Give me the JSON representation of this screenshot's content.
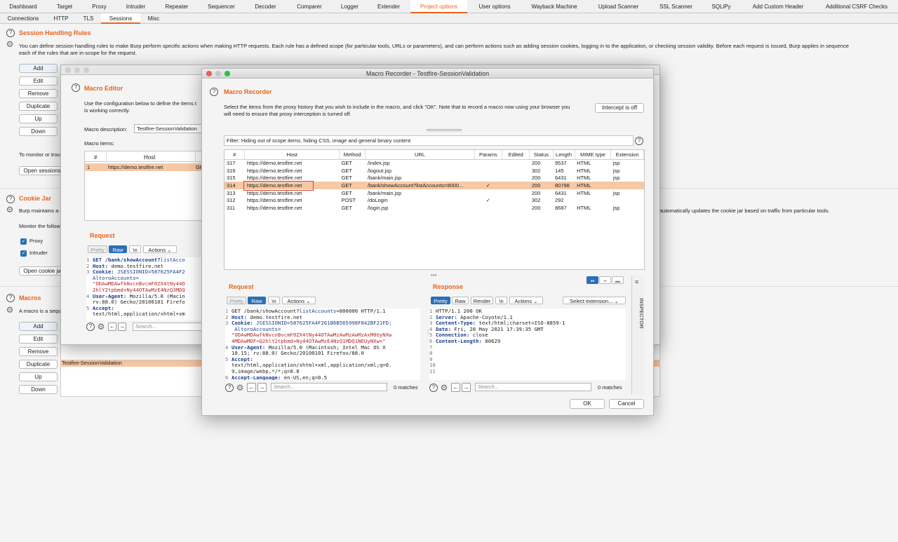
{
  "top_tabs": [
    {
      "label": "Dashboard",
      "active": false
    },
    {
      "label": "Target",
      "active": false
    },
    {
      "label": "Proxy",
      "active": false
    },
    {
      "label": "Intruder",
      "active": false
    },
    {
      "label": "Repeater",
      "active": false
    },
    {
      "label": "Sequencer",
      "active": false
    },
    {
      "label": "Decoder",
      "active": false
    },
    {
      "label": "Comparer",
      "active": false
    },
    {
      "label": "Logger",
      "active": false
    },
    {
      "label": "Extender",
      "active": false
    },
    {
      "label": "Project options",
      "active": true
    },
    {
      "label": "User options",
      "active": false
    },
    {
      "label": "Wayback Machine",
      "active": false
    },
    {
      "label": "Upload Scanner",
      "active": false
    },
    {
      "label": "SSL Scanner",
      "active": false
    },
    {
      "label": "SQLiPy",
      "active": false
    },
    {
      "label": "Add Custom Header",
      "active": false
    },
    {
      "label": "Additional CSRF Checks",
      "active": false
    }
  ],
  "sub_tabs": [
    {
      "label": "Connections",
      "active": false
    },
    {
      "label": "HTTP",
      "active": false
    },
    {
      "label": "TLS",
      "active": false
    },
    {
      "label": "Sessions",
      "active": true
    },
    {
      "label": "Misc",
      "active": false
    }
  ],
  "session_rules": {
    "title": "Session Handling Rules",
    "desc1": "You can define session handling rules to make Burp perform specific actions when making HTTP requests. Each rule has a defined scope (for particular tools, URLs or parameters), and can perform actions such as adding session cookies, logging in to the application, or checking session validity. Before each request is issued, Burp applies in sequence",
    "desc2": "each of the rules that are in-scope for the request.",
    "buttons": [
      "Add",
      "Edit",
      "Remove",
      "Duplicate",
      "Up",
      "Down"
    ],
    "monitor_text": "To monitor or trou",
    "open_sessions_btn": "Open sessions"
  },
  "cookie_jar": {
    "title": "Cookie Jar",
    "desc": "Burp maintains a c",
    "desc_right": "automatically updates the cookie jar based on traffic from particular tools.",
    "monitor": "Monitor the followi",
    "proxy": "Proxy",
    "intruder": "Intruder",
    "open_btn": "Open cookie ja"
  },
  "macros": {
    "title": "Macros",
    "desc": "A macro is a sequ",
    "buttons": [
      "Add",
      "Edit",
      "Remove",
      "Duplicate",
      "Up",
      "Down"
    ],
    "selected_macro": "Testfire-SessionValidation"
  },
  "macro_editor": {
    "title": "Macro Editor",
    "desc1": "Use the configuration below to define the items t",
    "desc2": "is working correctly.",
    "desc_label": "Macro description:",
    "desc_value": "Testfire-SessionValidation",
    "items_label": "Macro items:",
    "col_num": "#",
    "col_host": "Host",
    "row_num": "1",
    "row_host": "https://demo.testfire.net",
    "row_extra": "GE",
    "request_title": "Request",
    "pretty": "Pretty",
    "raw": "Raw",
    "newline": "\\n",
    "actions": "Actions",
    "search_placeholder": "Search...",
    "code": [
      {
        "n": "1",
        "k": "GET /bank/showAccount?",
        "v": "listAcco",
        "cls": "hval-blue"
      },
      {
        "n": "2",
        "k": "Host:",
        "v": " demo.testfire.net",
        "cls": ""
      },
      {
        "n": "3",
        "k": "Cookie:",
        "v": " JSESSIONID=587625FA4F2",
        "cls": "hval-blue"
      },
      {
        "n": "",
        "k": "",
        "v": "AltoroAccounts=",
        "cls": "hval-blue"
      },
      {
        "n": "",
        "k": "",
        "v": "\"ODAwMDAwfkNvcnBvcmF0ZX4tNy44O",
        "cls": "hval-red"
      },
      {
        "n": "",
        "k": "",
        "v": "2hlY2tpbmd+Ny44OTAwMzE4NzQ3MDQ",
        "cls": "hval-red"
      },
      {
        "n": "4",
        "k": "User-Agent:",
        "v": " Mozilla/5.0 (Macin",
        "cls": ""
      },
      {
        "n": "",
        "k": "",
        "v": "rv:88.0) Gecko/20100101 Firefo",
        "cls": ""
      },
      {
        "n": "5",
        "k": "Accept:",
        "v": "",
        "cls": ""
      },
      {
        "n": "",
        "k": "",
        "v": "text/html,application/xhtml+xm",
        "cls": ""
      }
    ]
  },
  "macro_recorder": {
    "window_title": "Macro Recorder - Testfire-SessionValidation",
    "title": "Macro Recorder",
    "desc1": "Select the items from the proxy history that you wish to include in the macro, and click \"OK\". Note that to record a macro now using your browser you",
    "desc2": "will need to ensure that proxy interception is turned off.",
    "intercept_btn": "Intercept is off",
    "filter": "Filter: Hiding out of scope items;  hiding CSS, image and general binary content",
    "columns": [
      "#",
      "Host",
      "Method",
      "URL",
      "Params",
      "Edited",
      "Status",
      "Length",
      "MIME type",
      "Extension"
    ],
    "rows": [
      {
        "num": "317",
        "host": "https://demo.testfire.net",
        "method": "GET",
        "url": "/index.jsp",
        "params": "",
        "edited": "",
        "status": "200",
        "length": "9537",
        "mime": "HTML",
        "ext": "jsp",
        "selected": false
      },
      {
        "num": "316",
        "host": "https://demo.testfire.net",
        "method": "GET",
        "url": "/logout.jsp",
        "params": "",
        "edited": "",
        "status": "302",
        "length": "145",
        "mime": "HTML",
        "ext": "jsp",
        "selected": false
      },
      {
        "num": "315",
        "host": "https://demo.testfire.net",
        "method": "GET",
        "url": "/bank/main.jsp",
        "params": "",
        "edited": "",
        "status": "200",
        "length": "6431",
        "mime": "HTML",
        "ext": "jsp",
        "selected": false
      },
      {
        "num": "314",
        "host": "https://demo.testfire.net",
        "method": "GET",
        "url": "/bank/showAccount?listAccounts=8000...",
        "params": "✓",
        "edited": "",
        "status": "200",
        "length": "80798",
        "mime": "HTML",
        "ext": "",
        "selected": true
      },
      {
        "num": "313",
        "host": "https://demo.testfire.net",
        "method": "GET",
        "url": "/bank/main.jsp",
        "params": "",
        "edited": "",
        "status": "200",
        "length": "6431",
        "mime": "HTML",
        "ext": "jsp",
        "selected": false
      },
      {
        "num": "312",
        "host": "https://demo.testfire.net",
        "method": "POST",
        "url": "/doLogin",
        "params": "✓",
        "edited": "",
        "status": "302",
        "length": "292",
        "mime": "",
        "ext": "",
        "selected": false
      },
      {
        "num": "311",
        "host": "https://demo.testfire.net",
        "method": "GET",
        "url": "/login.jsp",
        "params": "",
        "edited": "",
        "status": "200",
        "length": "8687",
        "mime": "HTML",
        "ext": "jsp",
        "selected": false
      }
    ],
    "request": {
      "title": "Request",
      "pretty": "Pretty",
      "raw": "Raw",
      "newline": "\\n",
      "actions": "Actions",
      "search_placeholder": "Search...",
      "matches": "0 matches",
      "lines": [
        {
          "n": "1",
          "parts": [
            [
              "",
              "GET /bank/showAccount?"
            ],
            [
              "hval-blue",
              "listAccounts"
            ],
            [
              "",
              "=800000 HTTP/1.1"
            ]
          ]
        },
        {
          "n": "2",
          "parts": [
            [
              "hkey",
              "Host:"
            ],
            [
              "",
              " demo.testfire.net"
            ]
          ]
        },
        {
          "n": "3",
          "parts": [
            [
              "hkey",
              "Cookie:"
            ],
            [
              "hval-blue",
              " JSESSIONID=587625FA4F261B6B565998F842BF21FD;"
            ]
          ]
        },
        {
          "n": "",
          "parts": [
            [
              "hval-blue",
              " AltoroAccounts="
            ]
          ]
        },
        {
          "n": "",
          "parts": [
            [
              "hval-red",
              "\"ODAwMDAwfkNvcnBvcmF0ZX4tNy44OTAwMzAwMzAwMzAxM0UyNXw"
            ]
          ]
        },
        {
          "n": "",
          "parts": [
            [
              "hval-red",
              "4MDAwMDF+Q2hlY2tpbmd+Ny44OTAwMzE4NzQ1MDQ1NEUyNXw=\""
            ]
          ]
        },
        {
          "n": "4",
          "parts": [
            [
              "hkey",
              "User-Agent:"
            ],
            [
              "",
              " Mozilla/5.0 (Macintosh; Intel Mac OS X"
            ]
          ]
        },
        {
          "n": "",
          "parts": [
            [
              "",
              "10.15; rv:88.0) Gecko/20100101 Firefox/88.0"
            ]
          ]
        },
        {
          "n": "5",
          "parts": [
            [
              "hkey",
              "Accept:"
            ]
          ]
        },
        {
          "n": "",
          "parts": [
            [
              "",
              "text/html,application/xhtml+xml,application/xml;q=0."
            ]
          ]
        },
        {
          "n": "",
          "parts": [
            [
              "",
              "9,image/webp,*/*;q=0.8"
            ]
          ]
        },
        {
          "n": "6",
          "parts": [
            [
              "hkey",
              "Accept-Language:"
            ],
            [
              "",
              " en-US,en;q=0.5"
            ]
          ]
        }
      ]
    },
    "response": {
      "title": "Response",
      "pretty": "Pretty",
      "raw": "Raw",
      "render": "Render",
      "newline": "\\n",
      "actions": "Actions",
      "select_ext": "Select extension...",
      "search_placeholder": "Search...",
      "matches": "0 matches",
      "lines": [
        {
          "n": "1",
          "parts": [
            [
              "",
              "HTTP/1.1 200 OK"
            ]
          ]
        },
        {
          "n": "2",
          "parts": [
            [
              "hkey",
              "Server:"
            ],
            [
              "",
              " Apache-Coyote/1.1"
            ]
          ]
        },
        {
          "n": "3",
          "parts": [
            [
              "hkey",
              "Content-Type:"
            ],
            [
              "",
              " text/html;charset=ISO-8859-1"
            ]
          ]
        },
        {
          "n": "4",
          "parts": [
            [
              "hkey",
              "Date:"
            ],
            [
              "",
              " Fri, 28 May 2021 17:39:35 GMT"
            ]
          ]
        },
        {
          "n": "5",
          "parts": [
            [
              "hkey",
              "Connection:"
            ],
            [
              "",
              " close"
            ]
          ]
        },
        {
          "n": "6",
          "parts": [
            [
              "hkey",
              "Content-Length:"
            ],
            [
              "",
              " 80629"
            ]
          ]
        },
        {
          "n": "7",
          "parts": [
            [
              "",
              ""
            ]
          ]
        },
        {
          "n": "8",
          "parts": [
            [
              "",
              ""
            ]
          ]
        },
        {
          "n": "9",
          "parts": [
            [
              "",
              ""
            ]
          ]
        },
        {
          "n": "10",
          "parts": [
            [
              "",
              ""
            ]
          ]
        },
        {
          "n": "11",
          "parts": [
            [
              "",
              ""
            ]
          ]
        }
      ]
    },
    "inspector": "INSPECTOR",
    "ok": "OK",
    "cancel": "Cancel"
  },
  "colors": {
    "accent": "#e8641a",
    "selection": "#f6c8a6",
    "raw_on": "#2c6fb6",
    "highlight_box": "#d9452b"
  }
}
